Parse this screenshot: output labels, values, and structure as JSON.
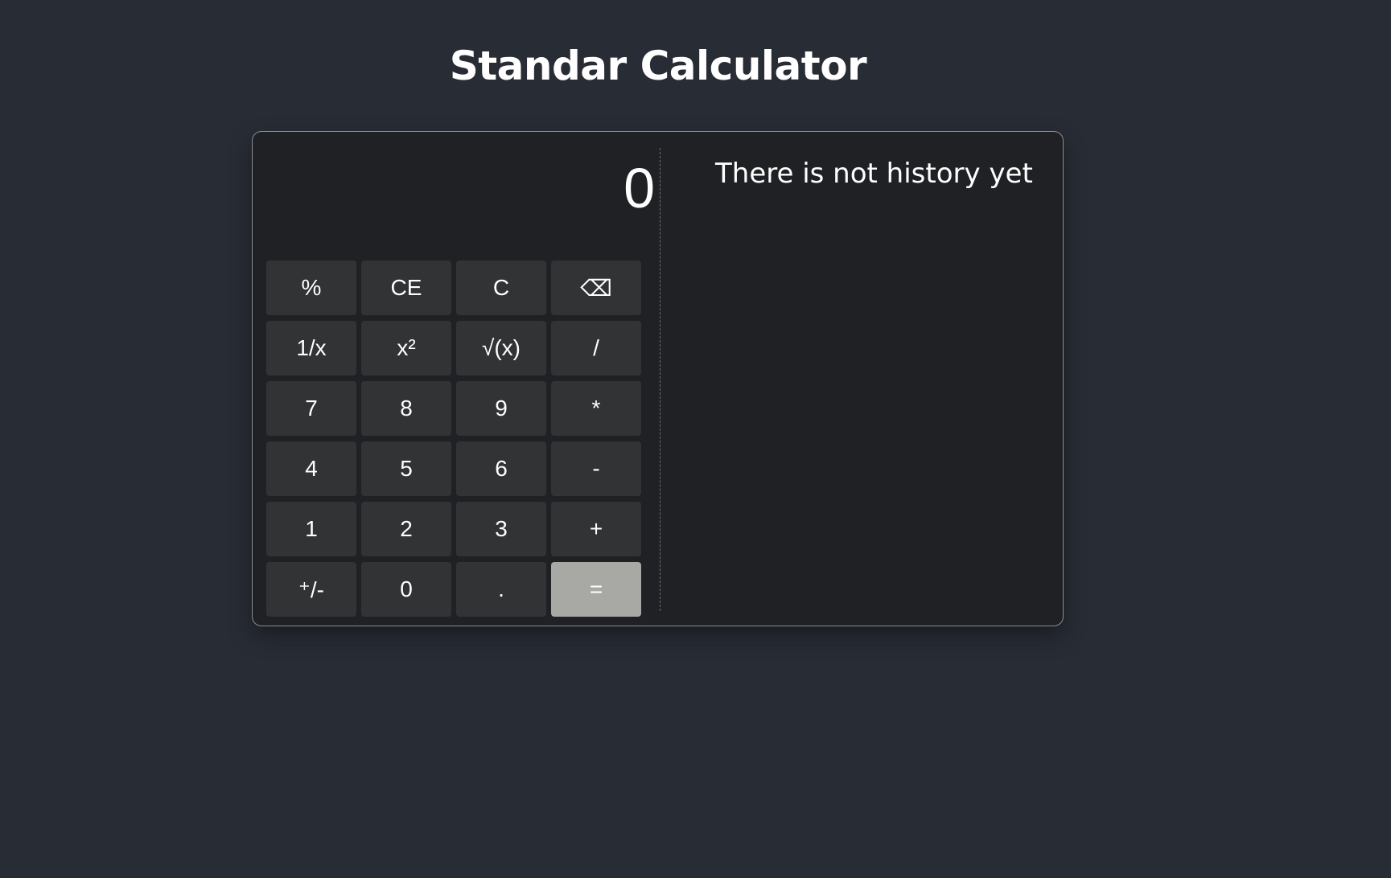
{
  "header": {
    "title": "Standar Calculator"
  },
  "display": {
    "value": "0"
  },
  "history": {
    "empty_message": "There is not history yet"
  },
  "keys": {
    "percent": "%",
    "clear_entry": "CE",
    "clear": "C",
    "backspace": "⌫",
    "reciprocal": "1/x",
    "square": "x²",
    "sqrt": "√(x)",
    "divide": "/",
    "seven": "7",
    "eight": "8",
    "nine": "9",
    "multiply": "*",
    "four": "4",
    "five": "5",
    "six": "6",
    "subtract": "-",
    "one": "1",
    "two": "2",
    "three": "3",
    "add": "+",
    "negate": "⁺/-",
    "zero": "0",
    "decimal": ".",
    "equals": "="
  },
  "colors": {
    "page_background": "#282c35",
    "panel_background": "#202124",
    "key_background": "#323335",
    "equals_background": "#a8a8a4"
  }
}
